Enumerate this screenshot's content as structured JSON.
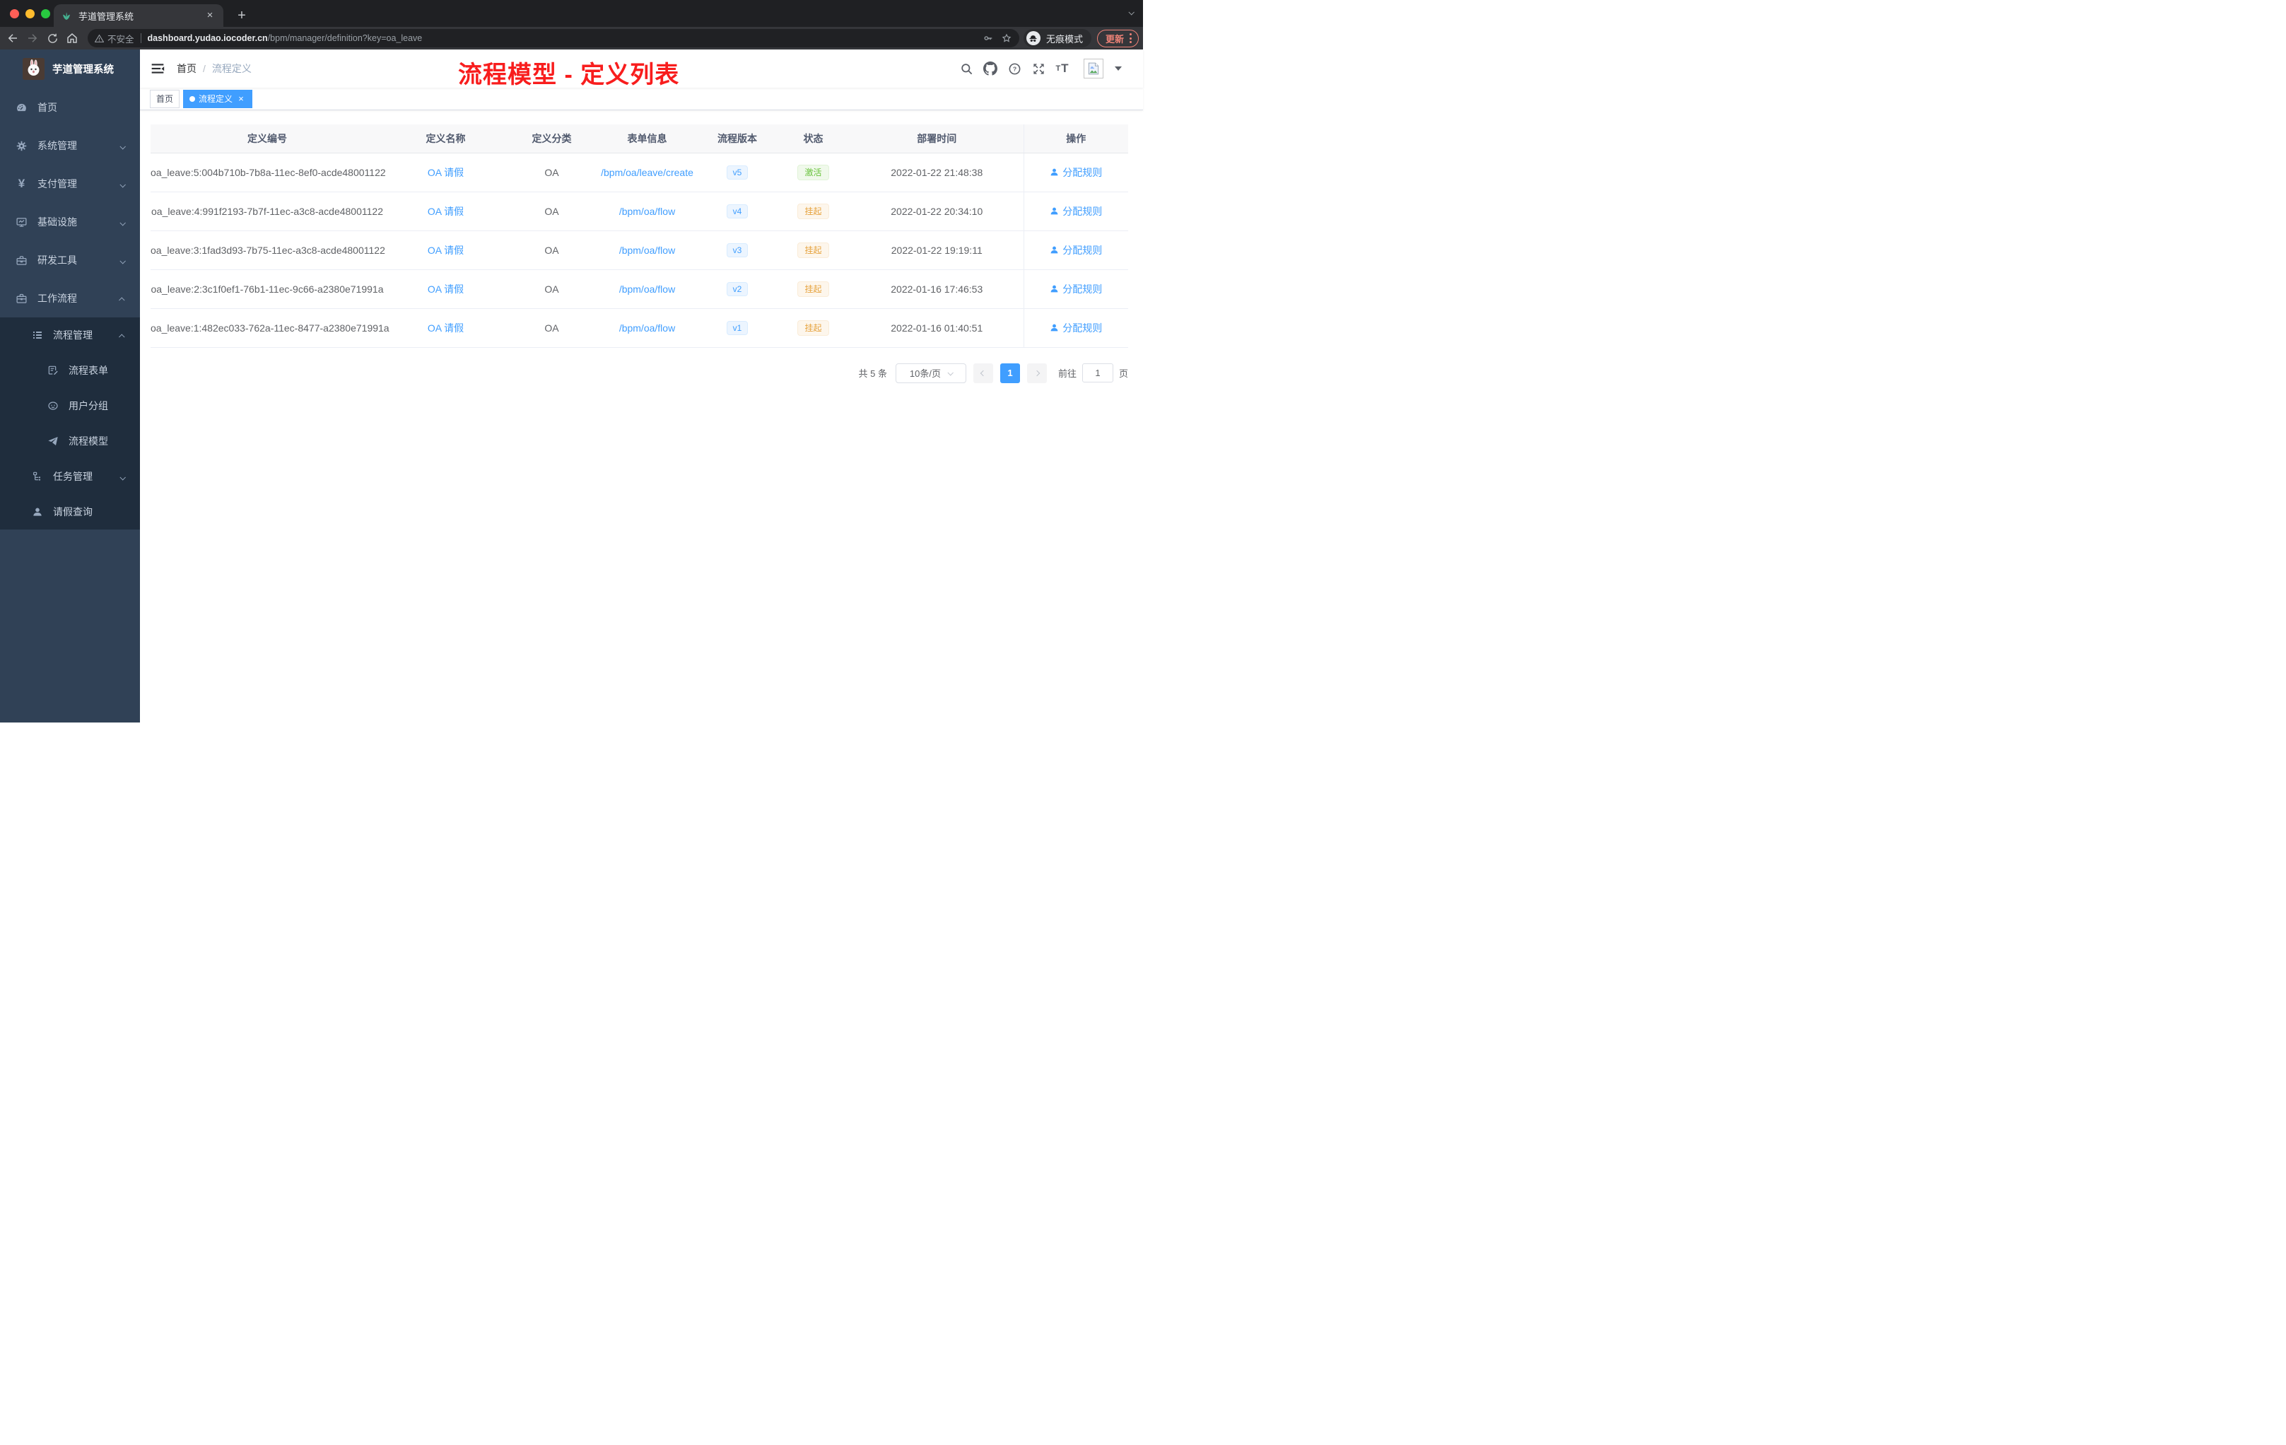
{
  "colors": {
    "accent": "#409eff",
    "sidebar_bg": "#304156",
    "submenu_bg": "#1f2d3d",
    "annotation_red": "#f81d1d",
    "status_success": "#67c23a",
    "status_warning": "#e6a23c",
    "update_button": "#ee8277"
  },
  "icons": {
    "close": "×",
    "plus": "+",
    "slash": "/",
    "yen": "¥",
    "t_small": "T",
    "t_large": "T"
  },
  "browser": {
    "tab_title": "芋道管理系统",
    "security_label": "不安全",
    "url_domain": "dashboard.yudao.iocoder.cn",
    "url_path": "/bpm/manager/definition?key=oa_leave",
    "incognito_label": "无痕模式",
    "update_label": "更新"
  },
  "sidebar": {
    "app_title": "芋道管理系统",
    "items": [
      {
        "label": "首页"
      },
      {
        "label": "系统管理"
      },
      {
        "label": "支付管理"
      },
      {
        "label": "基础设施"
      },
      {
        "label": "研发工具"
      },
      {
        "label": "工作流程"
      },
      {
        "label": "流程管理"
      },
      {
        "label": "流程表单"
      },
      {
        "label": "用户分组"
      },
      {
        "label": "流程模型"
      },
      {
        "label": "任务管理"
      },
      {
        "label": "请假查询"
      }
    ]
  },
  "header": {
    "breadcrumb": [
      "首页",
      "流程定义"
    ],
    "annotation": "流程模型 - 定义列表"
  },
  "tags": [
    {
      "label": "首页"
    },
    {
      "label": "流程定义"
    }
  ],
  "table": {
    "columns": [
      "定义编号",
      "定义名称",
      "定义分类",
      "表单信息",
      "流程版本",
      "状态",
      "部署时间",
      "操作"
    ],
    "action_label": "分配规则",
    "rows": [
      {
        "id": "oa_leave:5:004b710b-7b8a-11ec-8ef0-acde48001122",
        "name": "OA 请假",
        "category": "OA",
        "form": "/bpm/oa/leave/create",
        "version": "v5",
        "status": "激活",
        "deploy_time": "2022-01-22 21:48:38"
      },
      {
        "id": "oa_leave:4:991f2193-7b7f-11ec-a3c8-acde48001122",
        "name": "OA 请假",
        "category": "OA",
        "form": "/bpm/oa/flow",
        "version": "v4",
        "status": "挂起",
        "deploy_time": "2022-01-22 20:34:10"
      },
      {
        "id": "oa_leave:3:1fad3d93-7b75-11ec-a3c8-acde48001122",
        "name": "OA 请假",
        "category": "OA",
        "form": "/bpm/oa/flow",
        "version": "v3",
        "status": "挂起",
        "deploy_time": "2022-01-22 19:19:11"
      },
      {
        "id": "oa_leave:2:3c1f0ef1-76b1-11ec-9c66-a2380e71991a",
        "name": "OA 请假",
        "category": "OA",
        "form": "/bpm/oa/flow",
        "version": "v2",
        "status": "挂起",
        "deploy_time": "2022-01-16 17:46:53"
      },
      {
        "id": "oa_leave:1:482ec033-762a-11ec-8477-a2380e71991a",
        "name": "OA 请假",
        "category": "OA",
        "form": "/bpm/oa/flow",
        "version": "v1",
        "status": "挂起",
        "deploy_time": "2022-01-16 01:40:51"
      }
    ]
  },
  "pagination": {
    "total_label": "共 5 条",
    "page_size_label": "10条/页",
    "current_page": "1",
    "goto_label": "前往",
    "goto_value": "1",
    "page_unit_label": "页"
  }
}
